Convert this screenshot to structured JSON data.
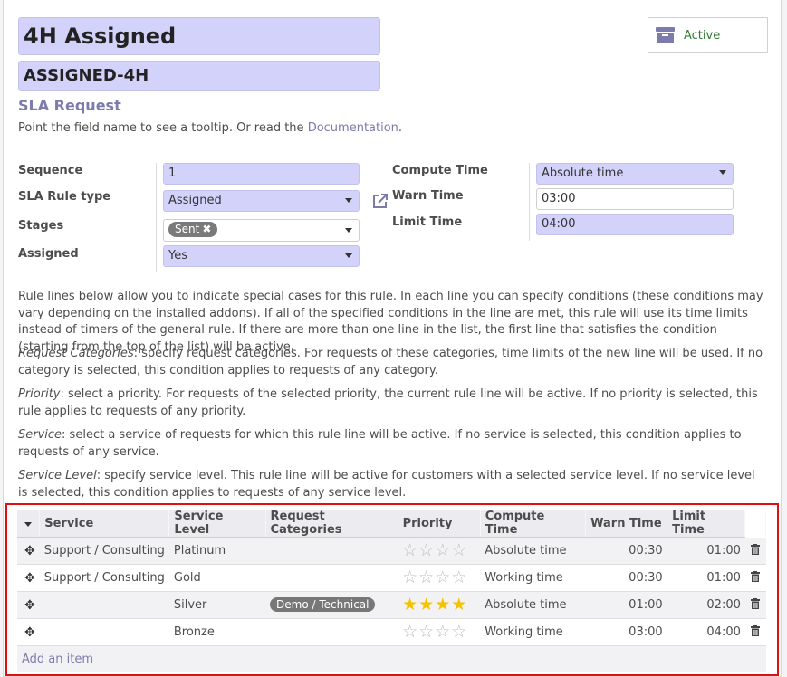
{
  "form": {
    "name": "4H Assigned",
    "code": "ASSIGNED-4H",
    "model": "SLA Request",
    "hint_prefix": "Point the field name to see a tooltip. Or read the",
    "hint_link": "Documentation",
    "hint_suffix": ".",
    "active_label": "Active"
  },
  "fields_left": {
    "sequence_label": "Sequence",
    "sequence_value": "1",
    "rule_type_label": "SLA Rule type",
    "rule_type_value": "Assigned",
    "stages_label": "Stages",
    "stages_tag": "Sent",
    "assigned_label": "Assigned",
    "assigned_value": "Yes"
  },
  "fields_right": {
    "compute_label": "Compute Time",
    "compute_value": "Absolute time",
    "warn_label": "Warn Time",
    "warn_value": "03:00",
    "limit_label": "Limit Time",
    "limit_value": "04:00"
  },
  "description": {
    "p1": "Rule lines below allow you to indicate special cases for this rule. In each line you can specify conditions (these conditions may vary depending on the installed addons). If all of the specified conditions in the line are met, this rule will use its time limits instead of timers of the general rule. If there are more than one line in the list, the first line that satisfies the condition (starting from the top of the list) will be active.",
    "p2_em": "Request Categories",
    "p2": ": specify request categories. For requests of these categories, time limits of the new line will be used. If no category is selected, this condition applies to requests of any category.",
    "p3_em": "Priority",
    "p3": ": select a priority. For requests of the selected priority, the current rule line will be active. If no priority is selected, this rule applies to requests of any priority.",
    "p4_em": "Service",
    "p4": ": select a service of requests for which this rule line will be active. If no service is selected, this condition applies to requests of any service.",
    "p5_em": "Service Level",
    "p5": ": specify service level. This rule line will be active for customers with a selected service level. If no service level is selected, this condition applies to requests of any service level."
  },
  "table": {
    "headers": [
      "Service",
      "Service Level",
      "Request Categories",
      "Priority",
      "Compute Time",
      "Warn Time",
      "Limit Time"
    ],
    "rows": [
      {
        "service": "Support / Consulting",
        "level": "Platinum",
        "category": "",
        "stars": 0,
        "compute": "Absolute time",
        "warn": "00:30",
        "limit": "01:00"
      },
      {
        "service": "Support / Consulting",
        "level": "Gold",
        "category": "",
        "stars": 0,
        "compute": "Working time",
        "warn": "00:30",
        "limit": "01:00"
      },
      {
        "service": "",
        "level": "Silver",
        "category": "Demo / Technical",
        "stars": 4,
        "compute": "Absolute time",
        "warn": "01:00",
        "limit": "02:00"
      },
      {
        "service": "",
        "level": "Bronze",
        "category": "",
        "stars": 0,
        "compute": "Working time",
        "warn": "03:00",
        "limit": "04:00"
      }
    ],
    "add_item": "Add an item"
  },
  "colors": {
    "accent": "#7c7bad",
    "field_bg": "#d3d2fb",
    "highlight": "#e01010",
    "star_on": "#f3c300",
    "active_green": "#2f7a32"
  },
  "icons": {
    "archive": "archive-box-icon",
    "external": "external-link-icon",
    "drag": "drag-handle-icon",
    "delete": "trash-icon",
    "star": "star-icon"
  }
}
